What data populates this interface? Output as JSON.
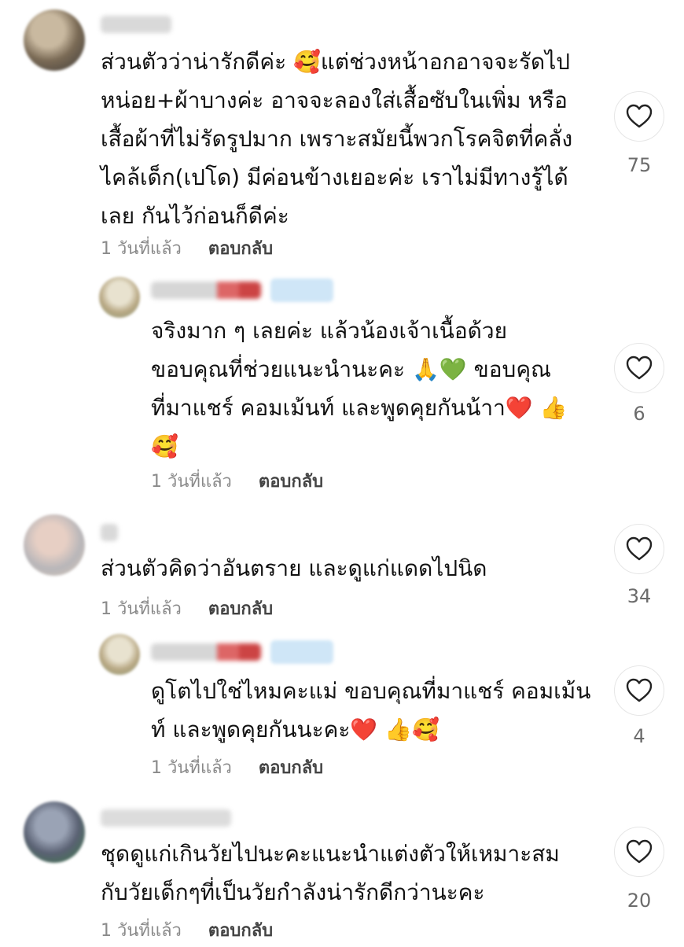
{
  "comments": [
    {
      "text": "ส่วนตัวว่าน่ารักดีค่ะ 🥰แต่ช่วงหน้าอกอาจจะรัดไปหน่อย+ผ้าบางค่ะ อาจจะลองใส่เสื้อซับในเพิ่ม หรือเสื้อผ้าที่ไม่รัดรูปมาก เพราะสมัยนี้พวกโรคจิตที่คลั่งไคล้เด็ก(เปโด) มีค่อนข้างเยอะค่ะ เราไม่มีทางรู้ได้เลย กันไว้ก่อนก็ดีค่ะ",
      "time": "1 วันที่แล้ว",
      "reply": "ตอบกลับ",
      "likes": "75"
    },
    {
      "text": "จริงมาก ๆ เลยค่ะ แล้วน้องเจ้าเนื้อด้วย ขอบคุณที่ช่วยแนะนำนะคะ 🙏💚 ขอบคุณที่มาแชร์ คอมเม้นท์ และพูดคุยกันน้าา❤️ 👍 🥰",
      "time": "1 วันที่แล้ว",
      "reply": "ตอบกลับ",
      "likes": "6"
    },
    {
      "text": "ส่วนตัวคิดว่าอันตราย และดูแก่แดดไปนิด",
      "time": "1 วันที่แล้ว",
      "reply": "ตอบกลับ",
      "likes": "34"
    },
    {
      "text": "ดูโตไปใช่ไหมคะแม่ ขอบคุณที่มาแชร์ คอมเม้นท์ และพูดคุยกันนะคะ❤️ 👍🥰",
      "time": "1 วันที่แล้ว",
      "reply": "ตอบกลับ",
      "likes": "4"
    },
    {
      "text": "ชุดดูแก่เกินวัยไปนะคะแนะนำแต่งตัวให้เหมาะสมกับวัยเด็กๆที่เป็นวัยกำลังน่ารักดีกว่านะคะ",
      "time": "1 วันที่แล้ว",
      "reply": "ตอบกลับ",
      "likes": "20"
    }
  ],
  "icons": {
    "like": "heart-outline-icon"
  },
  "colors": {
    "text": "#111111",
    "meta": "#8a8a8a",
    "reply": "#444444",
    "count": "#6b6b6b"
  }
}
